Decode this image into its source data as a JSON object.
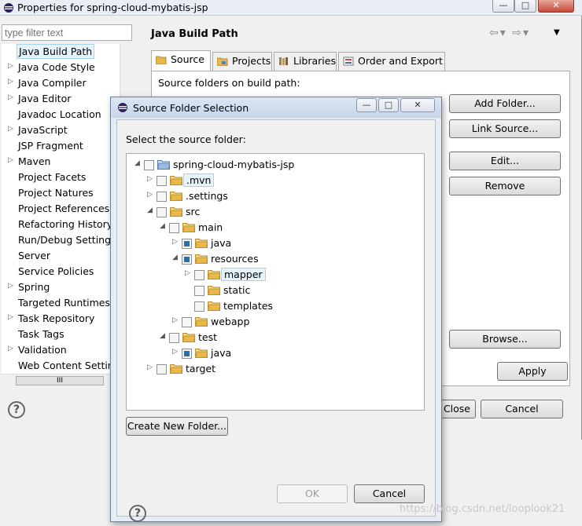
{
  "window": {
    "title": "Properties for spring-cloud-mybatis-jsp"
  },
  "filter": {
    "placeholder": "type filter text"
  },
  "nav_items": [
    {
      "label": "Java Build Path",
      "has_arrow": false,
      "selected": true
    },
    {
      "label": "Java Code Style",
      "has_arrow": true
    },
    {
      "label": "Java Compiler",
      "has_arrow": true
    },
    {
      "label": "Java Editor",
      "has_arrow": true
    },
    {
      "label": "Javadoc Location",
      "has_arrow": false
    },
    {
      "label": "JavaScript",
      "has_arrow": true
    },
    {
      "label": "JSP Fragment",
      "has_arrow": false
    },
    {
      "label": "Maven",
      "has_arrow": true
    },
    {
      "label": "Project Facets",
      "has_arrow": false
    },
    {
      "label": "Project Natures",
      "has_arrow": false
    },
    {
      "label": "Project References",
      "has_arrow": false
    },
    {
      "label": "Refactoring History",
      "has_arrow": false
    },
    {
      "label": "Run/Debug Settings",
      "has_arrow": false
    },
    {
      "label": "Server",
      "has_arrow": false
    },
    {
      "label": "Service Policies",
      "has_arrow": false
    },
    {
      "label": "Spring",
      "has_arrow": true
    },
    {
      "label": "Targeted Runtimes",
      "has_arrow": false
    },
    {
      "label": "Task Repository",
      "has_arrow": true
    },
    {
      "label": "Task Tags",
      "has_arrow": false
    },
    {
      "label": "Validation",
      "has_arrow": true
    },
    {
      "label": "Web Content Settings",
      "has_arrow": false
    }
  ],
  "hscroll_thumb": "III",
  "help_glyph": "?",
  "page": {
    "title": "Java Build Path"
  },
  "tabs": [
    {
      "label": "Source",
      "active": true
    },
    {
      "label": "Projects"
    },
    {
      "label": "Libraries"
    },
    {
      "label": "Order and Export"
    }
  ],
  "source_panel": {
    "label": "Source folders on build path:",
    "buttons": {
      "add_folder": "Add Folder...",
      "link_source": "Link Source...",
      "edit": "Edit...",
      "remove": "Remove",
      "browse": "Browse..."
    }
  },
  "bottom": {
    "apply": "Apply",
    "close": "Close",
    "cancel": "Cancel"
  },
  "dialog": {
    "title": "Source Folder Selection",
    "prompt": "Select the source folder:",
    "tree": [
      {
        "label": "spring-cloud-mybatis-jsp",
        "level": 0,
        "expander": "open",
        "check": "none",
        "icon": "project"
      },
      {
        "label": ".mvn",
        "level": 1,
        "expander": "closed",
        "check": "none",
        "icon": "folder",
        "highlight": true
      },
      {
        "label": ".settings",
        "level": 1,
        "expander": "closed",
        "check": "none",
        "icon": "folder"
      },
      {
        "label": "src",
        "level": 1,
        "expander": "open",
        "check": "none",
        "icon": "folder"
      },
      {
        "label": "main",
        "level": 2,
        "expander": "open",
        "check": "none",
        "icon": "folder"
      },
      {
        "label": "java",
        "level": 3,
        "expander": "closed",
        "check": "partial",
        "icon": "folder"
      },
      {
        "label": "resources",
        "level": 3,
        "expander": "open",
        "check": "partial",
        "icon": "folder"
      },
      {
        "label": "mapper",
        "level": 4,
        "expander": "closed",
        "check": "none",
        "icon": "folder",
        "highlight": true
      },
      {
        "label": "static",
        "level": 4,
        "expander": "none",
        "check": "none",
        "icon": "folder"
      },
      {
        "label": "templates",
        "level": 4,
        "expander": "none",
        "check": "none",
        "icon": "folder"
      },
      {
        "label": "webapp",
        "level": 3,
        "expander": "closed",
        "check": "none",
        "icon": "folder"
      },
      {
        "label": "test",
        "level": 2,
        "expander": "open",
        "check": "none",
        "icon": "folder"
      },
      {
        "label": "java",
        "level": 3,
        "expander": "closed",
        "check": "partial",
        "icon": "folder"
      },
      {
        "label": "target",
        "level": 1,
        "expander": "closed",
        "check": "none",
        "icon": "folder"
      }
    ],
    "create_new_folder": "Create New Folder...",
    "ok": "OK",
    "cancel": "Cancel"
  },
  "watermark": "https://blog.csdn.net/looplook21",
  "colors": {
    "selection_bg": "#e5f3fb",
    "selection_border": "#a5d4f0",
    "checkbox_partial": "#2b6ea8",
    "folder": "#e8b84a"
  }
}
